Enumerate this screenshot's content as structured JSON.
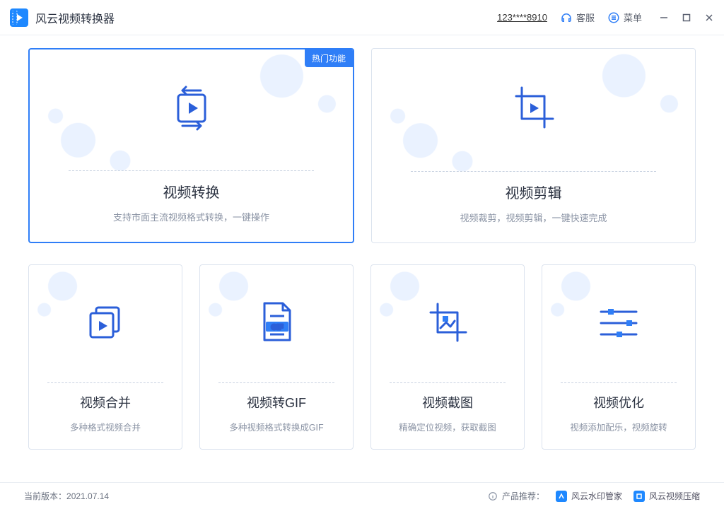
{
  "app": {
    "title": "风云视频转换器"
  },
  "header": {
    "account": "123****8910",
    "support_label": "客服",
    "menu_label": "菜单"
  },
  "cards": {
    "convert": {
      "badge": "热门功能",
      "title": "视频转换",
      "desc": "支持市面主流视频格式转换，一键操作"
    },
    "edit": {
      "title": "视频剪辑",
      "desc": "视频裁剪，视频剪辑，一键快速完成"
    },
    "merge": {
      "title": "视频合并",
      "desc": "多种格式视频合并"
    },
    "gif": {
      "title": "视频转GIF",
      "desc": "多种视频格式转换成GIF",
      "badge_text": "GIF"
    },
    "shot": {
      "title": "视频截图",
      "desc": "精确定位视频，获取截图"
    },
    "optimize": {
      "title": "视频优化",
      "desc": "视频添加配乐，视频旋转"
    }
  },
  "footer": {
    "version_label": "当前版本：",
    "version": "2021.07.14",
    "recommend_label": "产品推荐：",
    "rec1": "风云水印管家",
    "rec2": "风云视频压缩"
  }
}
